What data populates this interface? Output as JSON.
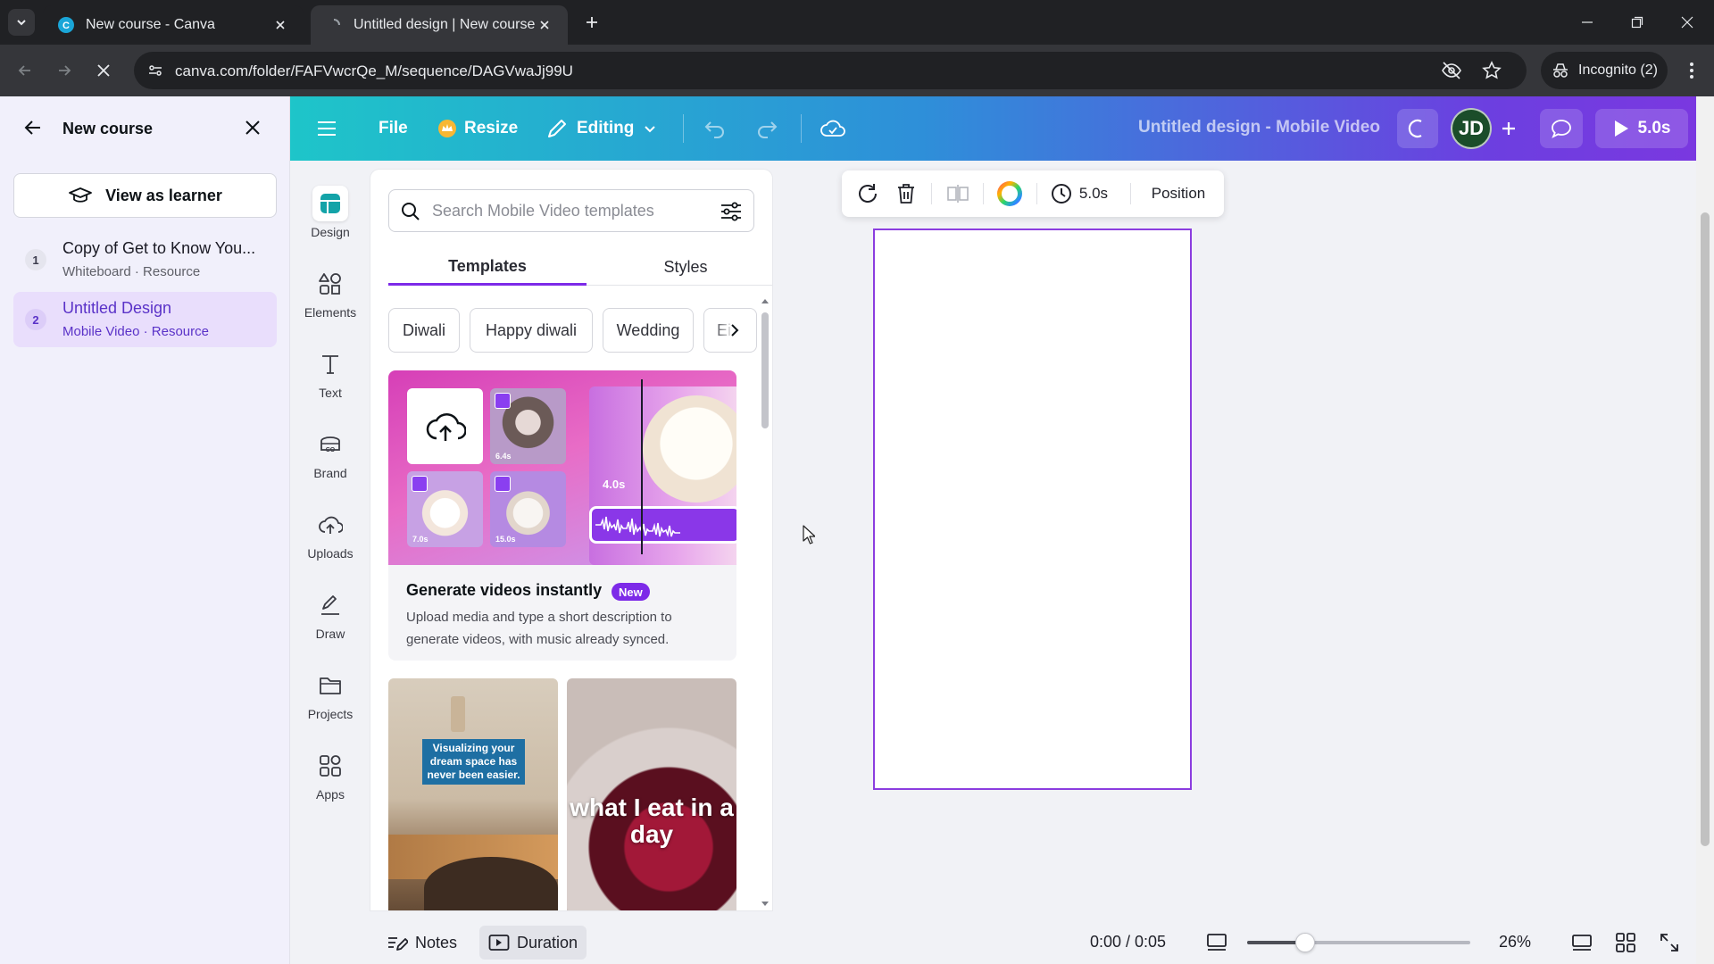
{
  "browser": {
    "tabs": [
      {
        "title": "New course - Canva",
        "active": false
      },
      {
        "title": "Untitled design | New course",
        "active": true
      }
    ],
    "url": "canva.com/folder/FAFVwcrQe_M/sequence/DAGVwaJj99U",
    "incognito_label": "Incognito (2)"
  },
  "course": {
    "title": "New course",
    "view_as_learner": "View as learner",
    "items": [
      {
        "num": "1",
        "title": "Copy of Get to Know You...",
        "meta": "Whiteboard · Resource"
      },
      {
        "num": "2",
        "title": "Untitled Design",
        "meta": "Mobile Video · Resource"
      }
    ]
  },
  "header": {
    "file": "File",
    "resize": "Resize",
    "editing": "Editing",
    "design_title": "Untitled design - Mobile Video",
    "avatar": "JD",
    "play_duration": "5.0s"
  },
  "rail": {
    "items": [
      {
        "label": "Design",
        "icon": "design-icon"
      },
      {
        "label": "Elements",
        "icon": "elements-icon"
      },
      {
        "label": "Text",
        "icon": "text-icon"
      },
      {
        "label": "Brand",
        "icon": "brand-icon"
      },
      {
        "label": "Uploads",
        "icon": "uploads-icon"
      },
      {
        "label": "Draw",
        "icon": "draw-icon"
      },
      {
        "label": "Projects",
        "icon": "projects-icon"
      },
      {
        "label": "Apps",
        "icon": "apps-icon"
      }
    ]
  },
  "panel": {
    "search_placeholder": "Search Mobile Video templates",
    "tabs": [
      "Templates",
      "Styles"
    ],
    "chips": [
      "Diwali",
      "Happy diwali",
      "Wedding",
      "Ei"
    ],
    "generate": {
      "title": "Generate videos instantly",
      "badge": "New",
      "description": "Upload media and type a short description to generate videos, with music already synced.",
      "timestamps": [
        "6.4s",
        "7.0s",
        "15.0s",
        "4.0s"
      ]
    },
    "thumbnails": [
      {
        "caption": "Visualizing your dream space has never been easier."
      },
      {
        "caption": "what I eat in a day"
      }
    ]
  },
  "context_bar": {
    "duration": "5.0s",
    "position": "Position"
  },
  "bottom": {
    "notes": "Notes",
    "duration": "Duration",
    "time": "0:00 / 0:05",
    "zoom": "26%",
    "zoom_level": 0.26
  },
  "colors": {
    "accent": "#7d2ae8",
    "page_border": "#8b3ddf"
  }
}
